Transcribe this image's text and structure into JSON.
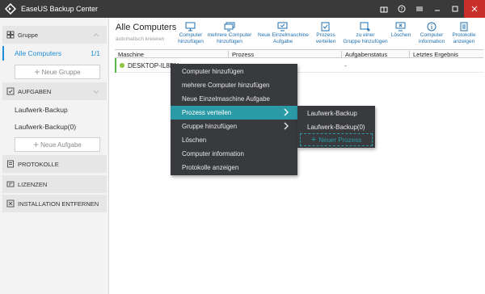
{
  "app": {
    "title": "EaseUS Backup Center"
  },
  "sidebar": {
    "group_header": "Gruppe",
    "all_computers": "Alle Computers",
    "all_computers_count": "1/1",
    "new_group": "Neue Gruppe",
    "tasks_header": "AUFGABEN",
    "tasks": [
      "Laufwerk-Backup",
      "Laufwerk-Backup(0)"
    ],
    "new_task": "Neue Aufgabe",
    "protocols": "PROTOKOLLE",
    "licenses": "LIZENZEN",
    "uninstall": "INSTALLATION ENTFERNEN"
  },
  "main": {
    "title": "Alle Computers",
    "subtitle": "automatisch kreieren",
    "toolbar": [
      "Computer\nhinzufügen",
      "mehrere Computer\nhinzufügen",
      "Neue Einzelmaschine\nAufgabe",
      "Prozess\nverteilen",
      "zu einer\nGruppe hinzufügen",
      "Löschen",
      "Computer\ninformation",
      "Protokolle\nanzeigen"
    ],
    "columns": [
      "Maschine",
      "Prozess",
      "Aufgabenstatus",
      "Letztes Ergebnis"
    ],
    "row": {
      "name": "DESKTOP-IL8EN",
      "status": "-"
    }
  },
  "context_menu": {
    "items": [
      "Computer hinzufügen",
      "mehrere Computer hinzufügen",
      "Neue Einzelmaschine Aufgabe",
      "Prozess verteilen",
      "Gruppe hinzufügen",
      "Löschen",
      "Computer information",
      "Protokolle anzeigen"
    ],
    "highlighted": "Prozess verteilen"
  },
  "submenu": {
    "items": [
      "Laufwerk-Backup",
      "Laufwerk-Backup(0)"
    ],
    "new_process": "Neuer Prozess"
  },
  "colors": {
    "accent": "#1f8dd6",
    "menu_bg": "#383a3e",
    "menu_highlight": "#2a9ba6",
    "titlebar": "#3a3a3a",
    "close": "#c9302c"
  }
}
